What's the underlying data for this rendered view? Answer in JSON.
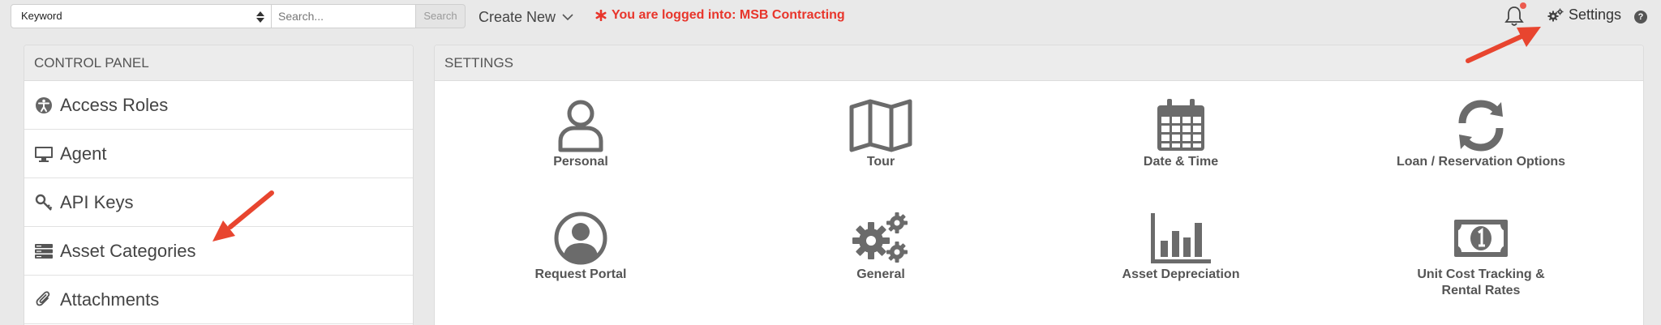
{
  "topbar": {
    "keyword_select": "Keyword",
    "search_placeholder": "Search...",
    "search_button": "Search",
    "create_new": "Create New",
    "logged_in_text": "You are logged into: MSB Contracting",
    "settings_label": "Settings",
    "help": "?"
  },
  "control_panel": {
    "title": "CONTROL PANEL",
    "items": [
      {
        "label": "Access Roles",
        "icon": "accessibility-icon"
      },
      {
        "label": "Agent",
        "icon": "monitor-icon"
      },
      {
        "label": "API Keys",
        "icon": "key-icon"
      },
      {
        "label": "Asset Categories",
        "icon": "server-stack-icon"
      },
      {
        "label": "Attachments",
        "icon": "paperclip-icon"
      }
    ]
  },
  "settings_panel": {
    "title": "SETTINGS",
    "tiles": [
      {
        "label": "Personal",
        "icon": "user-icon"
      },
      {
        "label": "Tour",
        "icon": "map-icon"
      },
      {
        "label": "Date & Time",
        "icon": "calendar-icon"
      },
      {
        "label": "Loan / Reservation Options",
        "icon": "refresh-icon"
      },
      {
        "label": "Request Portal",
        "icon": "user-circle-icon"
      },
      {
        "label": "General",
        "icon": "gears-icon"
      },
      {
        "label": "Asset Depreciation",
        "icon": "bar-chart-icon"
      },
      {
        "label": "Unit Cost Tracking &",
        "label2": "Rental Rates",
        "icon": "money-icon"
      }
    ]
  },
  "colors": {
    "alert_red": "#e8352b",
    "arrow_red": "#e8452f",
    "icon_gray": "#6b6b6b"
  }
}
